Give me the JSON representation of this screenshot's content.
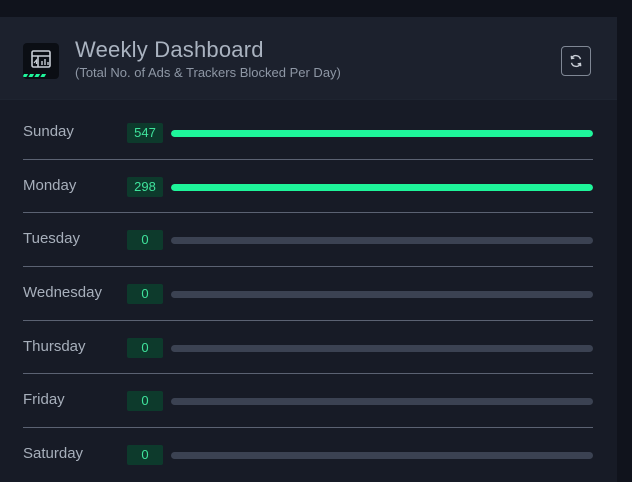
{
  "header": {
    "title": "Weekly Dashboard",
    "subtitle": "(Total No. of Ads & Trackers Blocked Per Day)",
    "logo_icon": "dashboard-chart-icon",
    "refresh_icon": "refresh-icon"
  },
  "colors": {
    "accent": "#1ef59a",
    "badge_bg": "#0d3a2c",
    "badge_text": "#3fe39c",
    "track": "#3b4252"
  },
  "days": [
    {
      "label": "Sunday",
      "count": "547",
      "progress": 1.0
    },
    {
      "label": "Monday",
      "count": "298",
      "progress": 1.0
    },
    {
      "label": "Tuesday",
      "count": "0",
      "progress": 0
    },
    {
      "label": "Wednesday",
      "count": "0",
      "progress": 0
    },
    {
      "label": "Thursday",
      "count": "0",
      "progress": 0
    },
    {
      "label": "Friday",
      "count": "0",
      "progress": 0
    },
    {
      "label": "Saturday",
      "count": "0",
      "progress": 0
    }
  ]
}
